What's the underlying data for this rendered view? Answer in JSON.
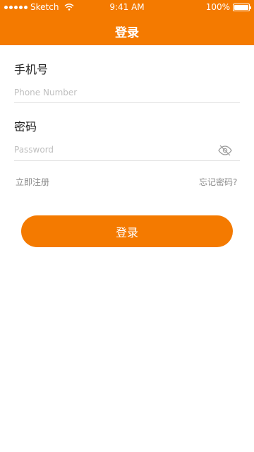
{
  "status_bar": {
    "carrier": "Sketch",
    "time": "9:41 AM",
    "battery": "100%",
    "battery_level": 1.0
  },
  "header": {
    "title": "登录"
  },
  "form": {
    "phone": {
      "label": "手机号",
      "placeholder": "Phone Number",
      "value": ""
    },
    "password": {
      "label": "密码",
      "placeholder": "Password",
      "value": "",
      "toggle_icon": "eye-off-icon"
    },
    "register_link": "立即注册",
    "forgot_link": "忘记密码?",
    "submit_label": "登录"
  },
  "colors": {
    "accent": "#f47a00",
    "label_text": "#222222",
    "link_text": "#8a8a8a",
    "placeholder": "#bfbfbf",
    "divider": "#e3e3e3"
  }
}
